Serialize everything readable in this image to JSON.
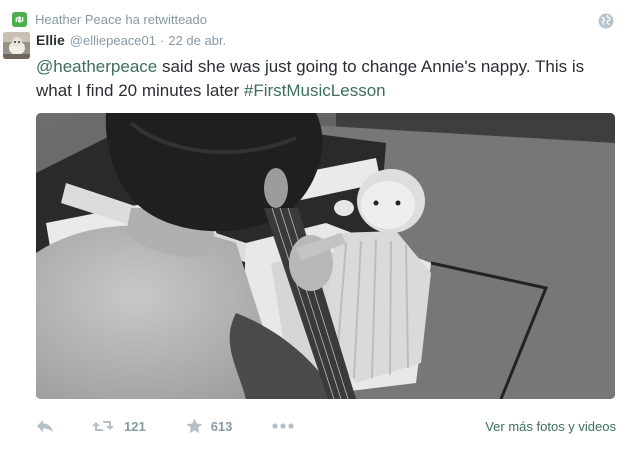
{
  "context": {
    "retweeted_by": "Heather Peace ha retwitteado"
  },
  "tweet": {
    "fullname": "Ellie",
    "username": "@elliepeace01",
    "separator": "·",
    "time": "22 de abr.",
    "text": {
      "mention": "@heatherpeace",
      "body": " said she was just going to change Annie's nappy. This is what I find 20 minutes later ",
      "hashtag": "#FirstMusicLesson"
    }
  },
  "actions": {
    "retweet_count": "121",
    "favorite_count": "613",
    "more_photos": "Ver más fotos y videos"
  },
  "colors": {
    "link": "#3b6f5b",
    "muted": "#8899a6",
    "retweet_badge": "#4cae4c"
  },
  "icons": [
    "retweet-icon",
    "globe-icon",
    "reply-icon",
    "retweet-action-icon",
    "star-icon",
    "more-icon"
  ]
}
